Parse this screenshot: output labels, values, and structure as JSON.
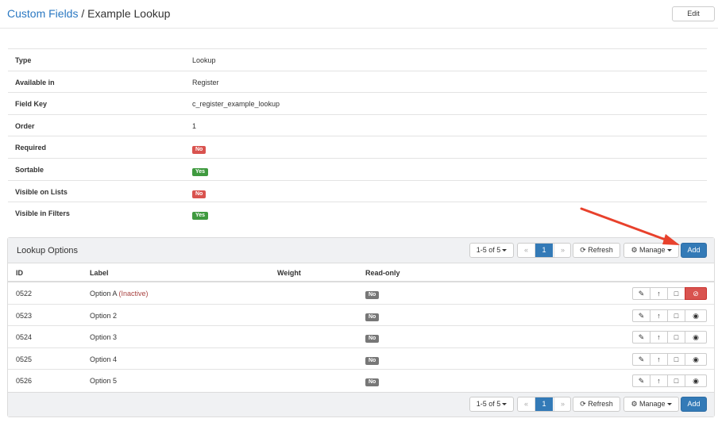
{
  "header": {
    "breadcrumb_link": "Custom Fields",
    "breadcrumb_sep": " / ",
    "title": "Example Lookup",
    "edit_label": "Edit"
  },
  "properties": [
    {
      "key": "Type",
      "value": "Lookup"
    },
    {
      "key": "Available in",
      "value": "Register"
    },
    {
      "key": "Field Key",
      "value": "c_register_example_lookup"
    },
    {
      "key": "Order",
      "value": "1"
    },
    {
      "key": "Required",
      "badge": "No"
    },
    {
      "key": "Sortable",
      "badge": "Yes"
    },
    {
      "key": "Visible on Lists",
      "badge": "No"
    },
    {
      "key": "Visible in Filters",
      "badge": "Yes"
    }
  ],
  "panel": {
    "title": "Lookup Options",
    "pager_count": "1-5 of 5",
    "pager_first": "«",
    "pager_page": "1",
    "pager_last": "»",
    "refresh_label": "Refresh",
    "manage_label": "Manage",
    "add_label": "Add",
    "columns": [
      "ID",
      "Label",
      "Weight",
      "Read-only"
    ],
    "rows": [
      {
        "id": "0522",
        "label": "Option A",
        "status": "(Inactive)",
        "read_only": "No"
      },
      {
        "id": "0523",
        "label": "Option 2",
        "status": "",
        "read_only": "No"
      },
      {
        "id": "0524",
        "label": "Option 3",
        "status": "",
        "read_only": "No"
      },
      {
        "id": "0525",
        "label": "Option 4",
        "status": "",
        "read_only": "No"
      },
      {
        "id": "0526",
        "label": "Option 5",
        "status": "",
        "read_only": "No"
      }
    ],
    "row_action_icons": [
      "pencil-icon",
      "arrow-up-icon",
      "square-icon",
      "eye-icon"
    ]
  },
  "colors": {
    "link": "#2a78c2",
    "primary": "#337ab7",
    "danger": "#d9534f",
    "success": "#3f9a3f",
    "annotation_arrow": "#e8412c"
  }
}
